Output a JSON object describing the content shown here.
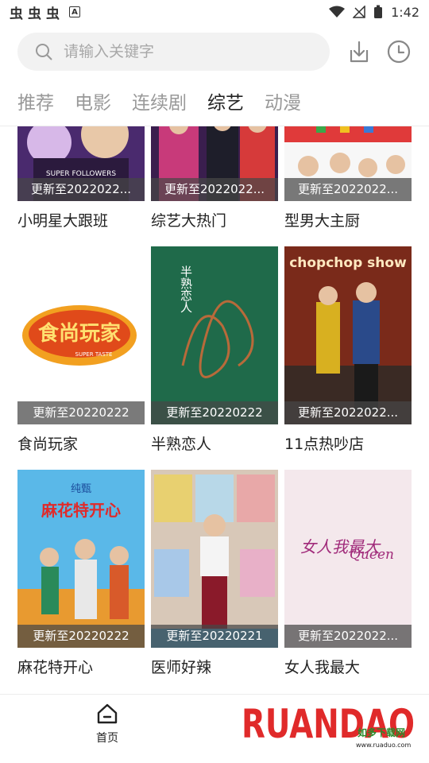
{
  "status_bar": {
    "left_icons": [
      "虫",
      "虫",
      "虫"
    ],
    "badge": "A",
    "time": "1:42"
  },
  "search": {
    "placeholder": "请输入关键字"
  },
  "tabs": [
    {
      "label": "推荐",
      "active": false
    },
    {
      "label": "电影",
      "active": false
    },
    {
      "label": "连续剧",
      "active": false
    },
    {
      "label": "综艺",
      "active": true
    },
    {
      "label": "动漫",
      "active": false
    }
  ],
  "cards": [
    {
      "title": "小明星大跟班",
      "update": "更新至2022022..."
    },
    {
      "title": "综艺大热门",
      "update": "更新至2022022..."
    },
    {
      "title": "型男大主厨",
      "update": "更新至2022022..."
    },
    {
      "title": "食尚玩家",
      "update": "更新至20220222"
    },
    {
      "title": "半熟恋人",
      "update": "更新至20220222"
    },
    {
      "title": "11点热吵店",
      "update": "更新至2022022..."
    },
    {
      "title": "麻花特开心",
      "update": "更新至20220222"
    },
    {
      "title": "医师好辣",
      "update": "更新至20220221"
    },
    {
      "title": "女人我最大",
      "update": "更新至2022022..."
    }
  ],
  "poster_text": {
    "c0": "SUPER FOLLOWERS",
    "c3_main": "食尚玩家",
    "c3_sub": "SUPER TASTE",
    "c4": "半熟恋人",
    "c5": "chopchop show",
    "c6_top": "纯甄",
    "c6_main": "麻花特开心",
    "c8_main": "女人我最大",
    "c8_sub": "Queen"
  },
  "bottom_nav": {
    "home_label": "首页"
  },
  "watermark": {
    "brand": "RUANDAO",
    "cn": "如多下载网",
    "url": "www.ruaduo.com"
  },
  "colors": {
    "accent": "#d9272e",
    "tab_inactive": "#999999",
    "search_bg": "#f2f2f2"
  }
}
